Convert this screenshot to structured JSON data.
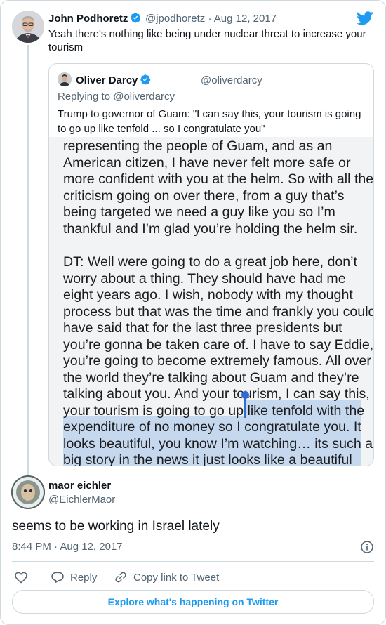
{
  "colors": {
    "accent": "#1d9bf0",
    "muted": "#536471",
    "border": "#cfd9de",
    "selection_highlight": "#c5d8ee",
    "selection_handle": "#2f6bd8"
  },
  "icons": [
    "verified-badge-icon",
    "twitter-bird-icon",
    "info-icon",
    "heart-icon",
    "reply-icon",
    "link-icon"
  ],
  "original_tweet": {
    "author_name": "John Podhoretz",
    "meta": "@jpodhoretz · Aug 12, 2017",
    "text": "Yeah there's nothing like being under nuclear threat to increase your tourism"
  },
  "quoted_tweet": {
    "author_name": "Oliver Darcy",
    "handle": "@oliverdarcy",
    "replying_to": "Replying to @oliverdarcy",
    "text": "Trump to governor of Guam: \"I can say this, your tourism is going to go up like tenfold ... so I congratulate you\"",
    "screenshot": {
      "paragraph1": [
        "representing the people of Guam, and as an",
        "American citizen, I have never felt more safe or",
        "more confident with you at the helm. So with all the",
        "criticism going on over there, from a guy that’s",
        "being targeted we need a guy like you so I’m",
        "thankful and I’m glad you’re holding the helm sir."
      ],
      "paragraph2": [
        "DT: Well were going to do a great job here, don’t",
        "worry about a thing. They should have had me",
        "eight years ago. I wish, nobody with my thought",
        "process but that was the time and frankly you could",
        "have said that for the last three presidents but",
        "you’re gonna be taken care of. I have to say Eddie,",
        "you’re going to become extremely famous. All over",
        "the world they’re talking about Guam and they’re",
        "talking about you. And your tourism, I can say this,",
        "your tourism is going to go up like tenfold with the",
        "expenditure of no money so I congratulate you. It",
        "looks beautiful, you know I’m watching… its such a",
        "big story in the news it just looks like a beautiful"
      ]
    }
  },
  "main_tweet": {
    "author_name": "maor eichler",
    "handle": "@EichlerMaor",
    "text": "seems to be working in Israel lately",
    "timestamp": "8:44 PM · Aug 12, 2017"
  },
  "actions": {
    "reply": "Reply",
    "copy_link": "Copy link to Tweet"
  },
  "explore": "Explore what's happening on Twitter"
}
